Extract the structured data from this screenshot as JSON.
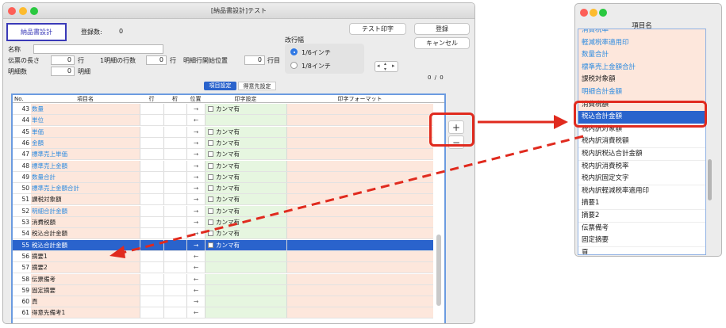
{
  "window": {
    "title": "[納品書設計]テスト"
  },
  "top": {
    "tab_label": "納品書設計",
    "reg_count_label": "登録数:",
    "reg_count_value": "0",
    "test_print": "テスト印字",
    "register": "登録",
    "cancel": "キャンセル"
  },
  "form": {
    "name_label": "名称",
    "slip_length_label": "伝票の長さ",
    "slip_length_value": "0",
    "row_unit": "行",
    "lines_per_detail_label": "1明細の行数",
    "lines_per_detail_value": "0",
    "lines_unit": "行",
    "detail_start_label": "明細行開始位置",
    "detail_start_value": "0",
    "detail_start_unit": "行目",
    "detail_count_label": "明細数",
    "detail_count_value": "0",
    "detail_count_unit": "明細",
    "line_pitch_label": "改行幅",
    "pitch_option_1": "1/6インチ",
    "pitch_option_2": "1/8インチ",
    "page_counter": "0 / 0"
  },
  "subtabs": {
    "items": "項目設定",
    "customer": "得意先設定"
  },
  "table": {
    "headers": {
      "no": "No.",
      "name": "項目名",
      "line": "行",
      "col": "桁",
      "pos": "位置",
      "print": "印字設定",
      "format": "印字フォーマット"
    },
    "rows": [
      {
        "no": "43",
        "name": "数量",
        "pos": "→",
        "check": true,
        "print": "カンマ有",
        "blue": true
      },
      {
        "no": "44",
        "name": "単位",
        "pos": "←",
        "check": false,
        "print": "",
        "blue": true
      },
      {
        "no": "45",
        "name": "単価",
        "pos": "→",
        "check": true,
        "print": "カンマ有",
        "blue": true
      },
      {
        "no": "46",
        "name": "金額",
        "pos": "→",
        "check": true,
        "print": "カンマ有",
        "blue": true
      },
      {
        "no": "47",
        "name": "標準売上単価",
        "pos": "→",
        "check": true,
        "print": "カンマ有",
        "blue": true
      },
      {
        "no": "48",
        "name": "標準売上金額",
        "pos": "→",
        "check": true,
        "print": "カンマ有",
        "blue": true
      },
      {
        "no": "49",
        "name": "数量合計",
        "pos": "→",
        "check": true,
        "print": "カンマ有",
        "blue": true
      },
      {
        "no": "50",
        "name": "標準売上金額合計",
        "pos": "→",
        "check": true,
        "print": "カンマ有",
        "blue": true
      },
      {
        "no": "51",
        "name": "課税対象額",
        "pos": "→",
        "check": true,
        "print": "カンマ有",
        "blue": false
      },
      {
        "no": "52",
        "name": "明細合計金額",
        "pos": "→",
        "check": true,
        "print": "カンマ有",
        "blue": true
      },
      {
        "no": "53",
        "name": "消費税額",
        "pos": "→",
        "check": true,
        "print": "カンマ有",
        "blue": false
      },
      {
        "no": "54",
        "name": "税込合計金額",
        "pos": "→",
        "check": true,
        "print": "カンマ有",
        "blue": false
      },
      {
        "no": "55",
        "name": "税込合計金額",
        "pos": "→",
        "check": true,
        "print": "カンマ有",
        "blue": false,
        "selected": true
      },
      {
        "no": "56",
        "name": "摘要1",
        "pos": "←",
        "check": false,
        "print": "",
        "blue": false
      },
      {
        "no": "57",
        "name": "摘要2",
        "pos": "←",
        "check": false,
        "print": "",
        "blue": false
      },
      {
        "no": "58",
        "name": "伝票備考",
        "pos": "←",
        "check": false,
        "print": "",
        "blue": false
      },
      {
        "no": "59",
        "name": "固定摘要",
        "pos": "←",
        "check": false,
        "print": "",
        "blue": false
      },
      {
        "no": "60",
        "name": "頁",
        "pos": "→",
        "check": false,
        "print": "",
        "blue": false
      },
      {
        "no": "61",
        "name": "得意先備考1",
        "pos": "←",
        "check": false,
        "print": "",
        "blue": false
      }
    ]
  },
  "side_buttons": {
    "add": "+",
    "remove": "−"
  },
  "popup": {
    "header": "項目名",
    "items": [
      {
        "label": "消費税率",
        "style": "orange"
      },
      {
        "label": "軽減税率適用印",
        "style": "orange"
      },
      {
        "label": "数量合計",
        "style": "orange"
      },
      {
        "label": "標準売上金額合計",
        "style": "orange"
      },
      {
        "label": "課税対象額",
        "style": "orange-dark"
      },
      {
        "label": "明細合計金額",
        "style": "orange"
      },
      {
        "label": "消費税額",
        "style": "orange-dark"
      },
      {
        "label": "税込合計金額",
        "style": "selected"
      },
      {
        "label": "税内訳対象額",
        "style": "white"
      },
      {
        "label": "税内訳消費税額",
        "style": "white"
      },
      {
        "label": "税内訳税込合計金額",
        "style": "white"
      },
      {
        "label": "税内訳消費税率",
        "style": "white"
      },
      {
        "label": "税内訳固定文字",
        "style": "white"
      },
      {
        "label": "税内訳軽減税率適用印",
        "style": "white"
      },
      {
        "label": "摘要1",
        "style": "white"
      },
      {
        "label": "摘要2",
        "style": "white"
      },
      {
        "label": "伝票備考",
        "style": "white"
      },
      {
        "label": "固定摘要",
        "style": "white"
      },
      {
        "label": "頁",
        "style": "white"
      }
    ]
  },
  "colors": {
    "accent": "#2a63cc",
    "annotation_red": "#e02a1e",
    "name_bg": "#fde7dc",
    "print_bg": "#e6f6e0",
    "item_blue": "#2d8be0"
  },
  "icons": [
    "close-dot",
    "minimize-dot",
    "zoom-dot",
    "stepper-icon",
    "checkbox"
  ]
}
